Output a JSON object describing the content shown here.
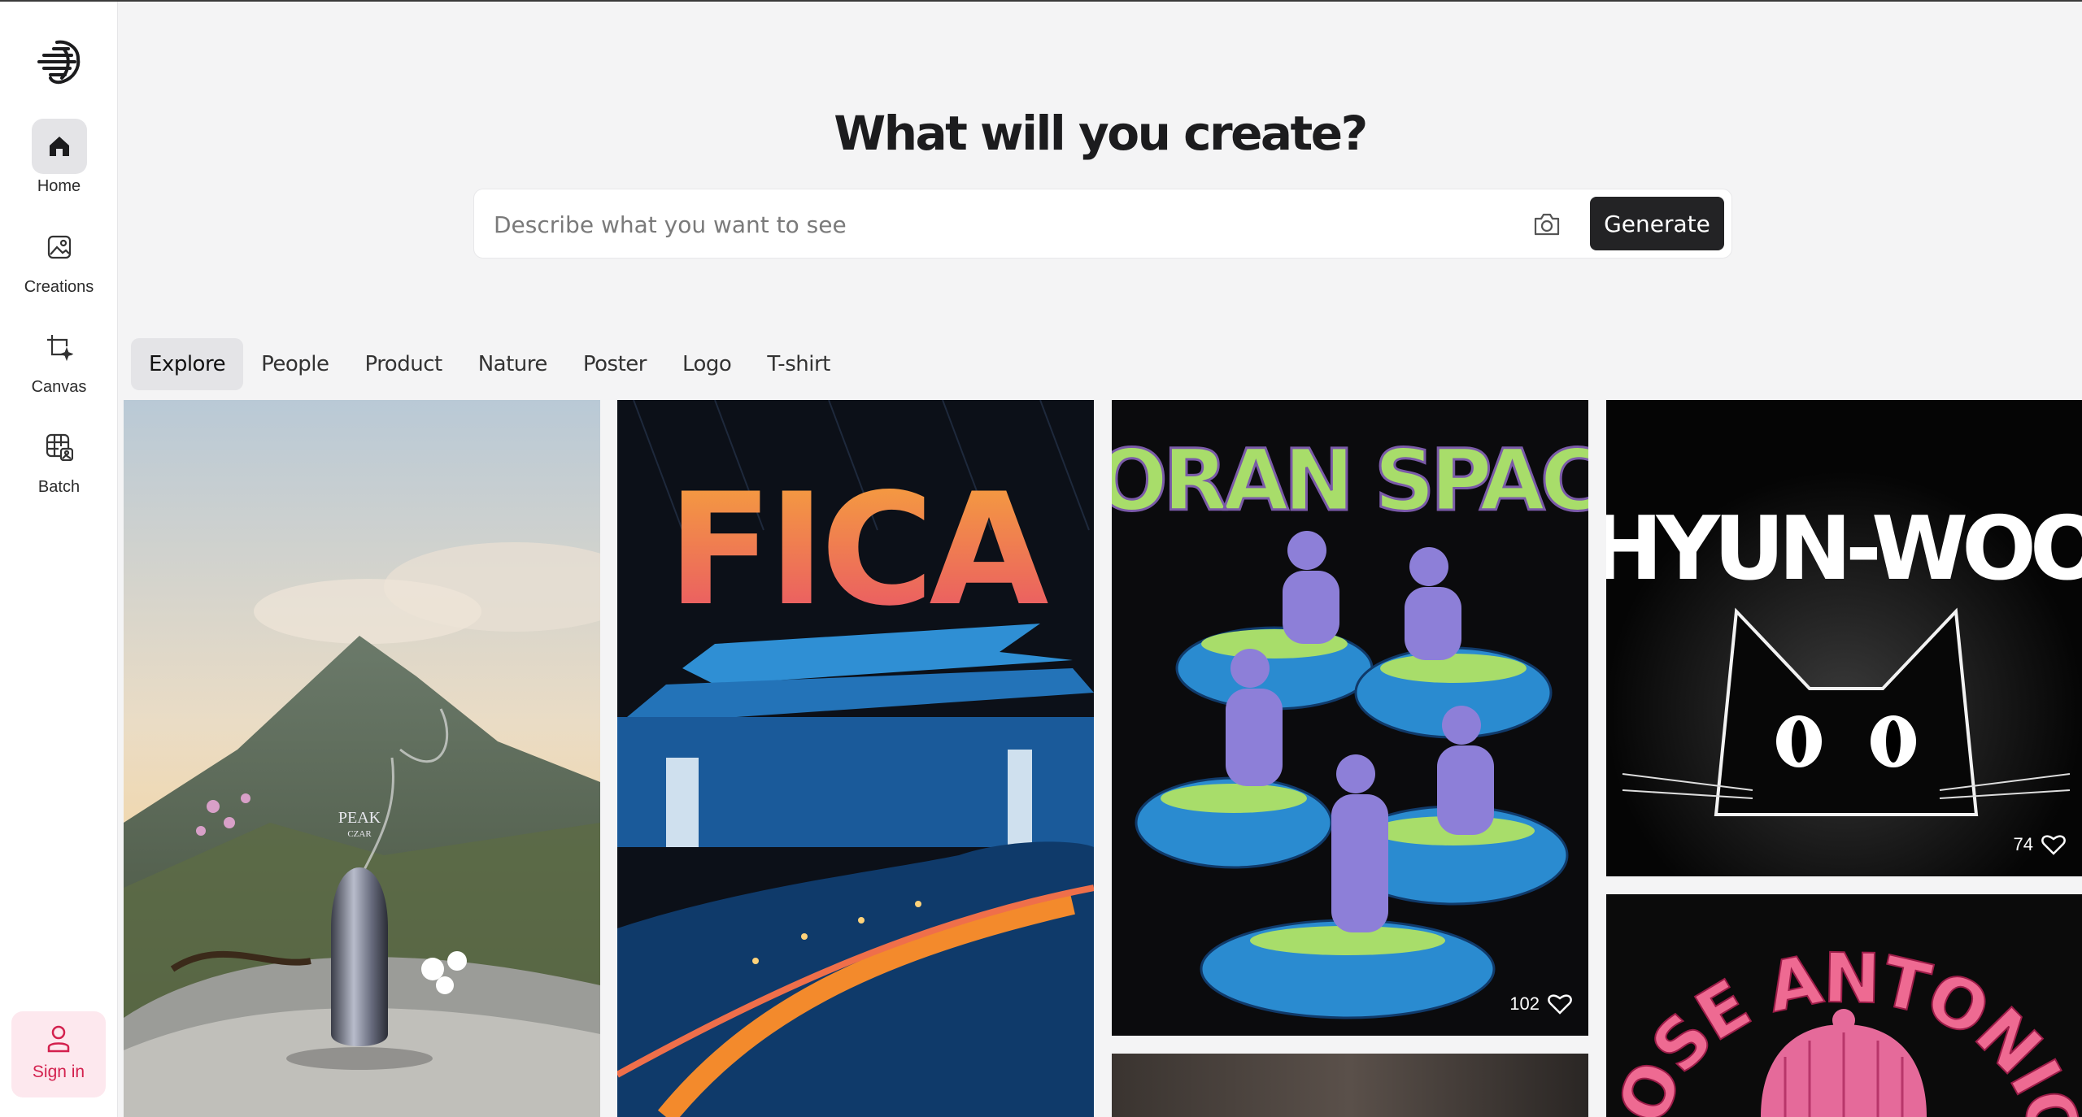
{
  "sidebar": {
    "items": [
      {
        "label": "Home",
        "icon": "home-icon",
        "active": true
      },
      {
        "label": "Creations",
        "icon": "image-icon"
      },
      {
        "label": "Canvas",
        "icon": "canvas-icon"
      },
      {
        "label": "Batch",
        "icon": "batch-icon"
      }
    ],
    "signin_label": "Sign in"
  },
  "header": {
    "title": "What will you create?",
    "search_placeholder": "Describe what you want to see",
    "generate_label": "Generate"
  },
  "tabs": [
    "Explore",
    "People",
    "Product",
    "Nature",
    "Poster",
    "Logo",
    "T-shirt"
  ],
  "gallery": {
    "perfume": {
      "bottle_text": "PEAK",
      "bottle_subtext": "CZAR"
    },
    "fica": {
      "title": "FICA"
    },
    "loran": {
      "title": "LORAN SPACE",
      "likes": "102"
    },
    "hyunwoo": {
      "title": "HYUN-WOO",
      "likes": "74"
    },
    "jose": {
      "title": "JOSE ANTONIO"
    }
  },
  "colors": {
    "brand_pink": "#d3214e",
    "dark_button": "#232325",
    "accent_lime": "#a8dd6a"
  }
}
